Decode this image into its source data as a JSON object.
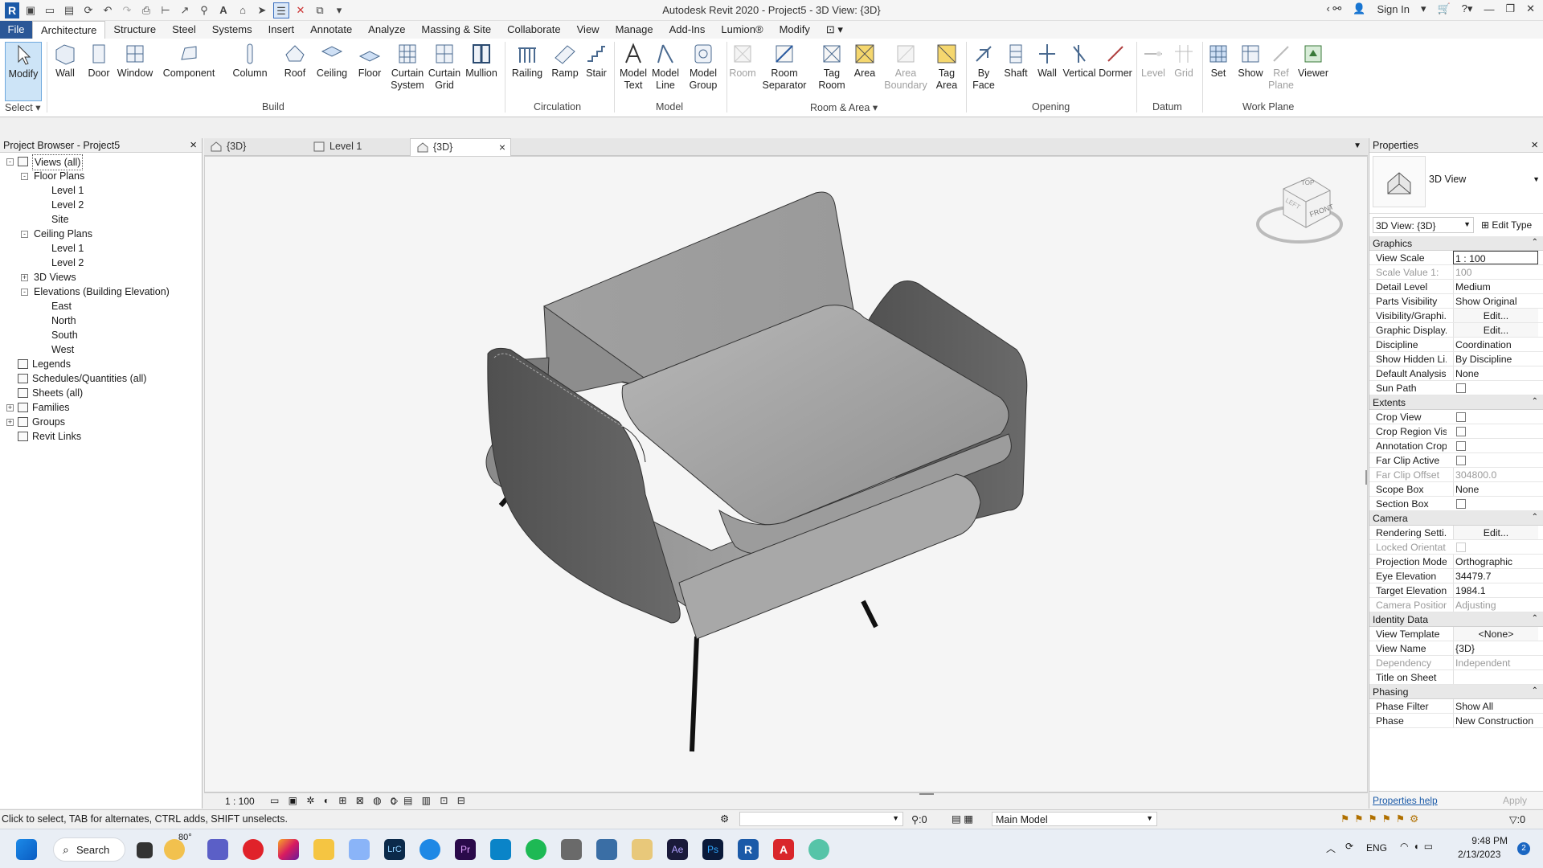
{
  "window": {
    "title": "Autodesk Revit 2020 - Project5 - 3D View: {3D}",
    "sign_in": "Sign In"
  },
  "ribbon_tabs": [
    "File",
    "Architecture",
    "Structure",
    "Steel",
    "Systems",
    "Insert",
    "Annotate",
    "Analyze",
    "Massing & Site",
    "Collaborate",
    "View",
    "Manage",
    "Add-Ins",
    "Lumion®",
    "Modify"
  ],
  "ribbon": {
    "modify": "Modify",
    "select": "Select",
    "wall": "Wall",
    "door": "Door",
    "window": "Window",
    "component": "Component",
    "column": "Column",
    "roof": "Roof",
    "ceiling": "Ceiling",
    "floor": "Floor",
    "curtain_system": [
      "Curtain",
      "System"
    ],
    "curtain_grid": [
      "Curtain",
      "Grid"
    ],
    "mullion": "Mullion",
    "railing": "Railing",
    "ramp": "Ramp",
    "stair": "Stair",
    "model_text": [
      "Model",
      "Text"
    ],
    "model_line": [
      "Model",
      "Line"
    ],
    "model_group": [
      "Model",
      "Group"
    ],
    "room": "Room",
    "room_separator": [
      "Room",
      "Separator"
    ],
    "tag_room": [
      "Tag",
      "Room"
    ],
    "area": "Area",
    "area_boundary": [
      "Area",
      "Boundary"
    ],
    "tag_area": [
      "Tag",
      "Area"
    ],
    "by_face": [
      "By",
      "Face"
    ],
    "shaft": "Shaft",
    "wall_op": "Wall",
    "vertical": "Vertical",
    "dormer": "Dormer",
    "level": "Level",
    "grid": "Grid",
    "set": "Set",
    "show": "Show",
    "ref_plane": [
      "Ref",
      "Plane"
    ],
    "viewer": "Viewer",
    "panels": {
      "build": "Build",
      "circulation": "Circulation",
      "model": "Model",
      "room_area": "Room & Area",
      "opening": "Opening",
      "datum": "Datum",
      "work_plane": "Work Plane"
    }
  },
  "project_browser": {
    "title": "Project Browser - Project5",
    "items": [
      {
        "label": "Views (all)",
        "indent": 0,
        "pm": "-",
        "icon": "views-icon",
        "selected": true
      },
      {
        "label": "Floor Plans",
        "indent": 1,
        "pm": "-"
      },
      {
        "label": "Level 1",
        "indent": 2
      },
      {
        "label": "Level 2",
        "indent": 2
      },
      {
        "label": "Site",
        "indent": 2
      },
      {
        "label": "Ceiling Plans",
        "indent": 1,
        "pm": "-"
      },
      {
        "label": "Level 1",
        "indent": 2
      },
      {
        "label": "Level 2",
        "indent": 2
      },
      {
        "label": "3D Views",
        "indent": 1,
        "pm": "+"
      },
      {
        "label": "Elevations (Building Elevation)",
        "indent": 1,
        "pm": "-"
      },
      {
        "label": "East",
        "indent": 2
      },
      {
        "label": "North",
        "indent": 2
      },
      {
        "label": "South",
        "indent": 2
      },
      {
        "label": "West",
        "indent": 2
      },
      {
        "label": "Legends",
        "indent": 0,
        "icon": "legends-icon"
      },
      {
        "label": "Schedules/Quantities (all)",
        "indent": 0,
        "icon": "schedules-icon"
      },
      {
        "label": "Sheets (all)",
        "indent": 0,
        "icon": "sheets-icon"
      },
      {
        "label": "Families",
        "indent": 0,
        "pm": "+",
        "icon": "families-icon"
      },
      {
        "label": "Groups",
        "indent": 0,
        "pm": "+",
        "icon": "groups-icon"
      },
      {
        "label": "Revit Links",
        "indent": 0,
        "icon": "links-icon"
      }
    ]
  },
  "view_tabs": [
    {
      "label": "{3D}"
    },
    {
      "label": "Level 1"
    },
    {
      "label": "{3D}",
      "active": true
    }
  ],
  "viewcube": {
    "top": "TOP",
    "front": "FRONT",
    "left": "LEFT"
  },
  "view_control": {
    "scale": "1 : 100",
    "count": "0"
  },
  "properties": {
    "title": "Properties",
    "type_name": "3D View",
    "selector": "3D View: {3D}",
    "edit_type": "Edit Type",
    "groups": [
      {
        "name": "Graphics",
        "rows": [
          {
            "k": "View Scale",
            "v": "1 : 100",
            "box": true
          },
          {
            "k": "Scale Value    1:",
            "v": "100",
            "gray": true
          },
          {
            "k": "Detail Level",
            "v": "Medium"
          },
          {
            "k": "Parts Visibility",
            "v": "Show Original"
          },
          {
            "k": "Visibility/Graphi...",
            "v": "Edit...",
            "btn": true
          },
          {
            "k": "Graphic Display...",
            "v": "Edit...",
            "btn": true
          },
          {
            "k": "Discipline",
            "v": "Coordination"
          },
          {
            "k": "Show Hidden Li...",
            "v": "By Discipline"
          },
          {
            "k": "Default Analysis...",
            "v": "None"
          },
          {
            "k": "Sun Path",
            "chk": true
          }
        ]
      },
      {
        "name": "Extents",
        "rows": [
          {
            "k": "Crop View",
            "chk": true
          },
          {
            "k": "Crop Region Vis...",
            "chk": true
          },
          {
            "k": "Annotation Crop",
            "chk": true
          },
          {
            "k": "Far Clip Active",
            "chk": true
          },
          {
            "k": "Far Clip Offset",
            "v": "304800.0",
            "gray": true
          },
          {
            "k": "Scope Box",
            "v": "None"
          },
          {
            "k": "Section Box",
            "chk": true
          }
        ]
      },
      {
        "name": "Camera",
        "rows": [
          {
            "k": "Rendering Setti...",
            "v": "Edit...",
            "btn": true
          },
          {
            "k": "Locked Orientat...",
            "chk": true,
            "gray": true
          },
          {
            "k": "Projection Mode",
            "v": "Orthographic"
          },
          {
            "k": "Eye Elevation",
            "v": "34479.7"
          },
          {
            "k": "Target Elevation",
            "v": "1984.1"
          },
          {
            "k": "Camera Position",
            "v": "Adjusting",
            "gray": true
          }
        ]
      },
      {
        "name": "Identity Data",
        "rows": [
          {
            "k": "View Template",
            "v": "<None>",
            "btn": true
          },
          {
            "k": "View Name",
            "v": "{3D}"
          },
          {
            "k": "Dependency",
            "v": "Independent",
            "gray": true
          },
          {
            "k": "Title on Sheet",
            "v": ""
          }
        ]
      },
      {
        "name": "Phasing",
        "rows": [
          {
            "k": "Phase Filter",
            "v": "Show All"
          },
          {
            "k": "Phase",
            "v": "New Construction"
          }
        ]
      }
    ],
    "help": "Properties help",
    "apply": "Apply"
  },
  "status": {
    "hint": "Click to select, TAB for alternates, CTRL adds, SHIFT unselects.",
    "count": ":0",
    "model": "Main Model",
    "filter": ":0"
  },
  "taskbar": {
    "search": "Search",
    "weather": "80°",
    "lang": "ENG",
    "time": "9:48 PM",
    "date": "2/13/2023",
    "badge": "2"
  },
  "colors": {
    "file_tab": "#2b5797",
    "accent": "#1b5aa8"
  }
}
